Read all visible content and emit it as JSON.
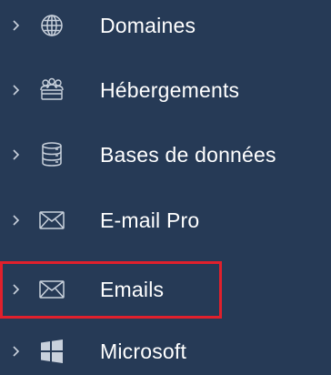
{
  "menu": {
    "items": [
      {
        "label": "Domaines",
        "icon": "globe-icon"
      },
      {
        "label": "Hébergements",
        "icon": "users-group-icon"
      },
      {
        "label": "Bases de données",
        "icon": "database-icon"
      },
      {
        "label": "E-mail Pro",
        "icon": "envelope-icon"
      },
      {
        "label": "Emails",
        "icon": "envelope-icon",
        "highlighted": true
      },
      {
        "label": "Microsoft",
        "icon": "windows-logo-icon"
      }
    ]
  },
  "colors": {
    "background": "#263a56",
    "text": "#ffffff",
    "icon_stroke": "#c9d1dc",
    "highlight_border": "#e0202c"
  }
}
